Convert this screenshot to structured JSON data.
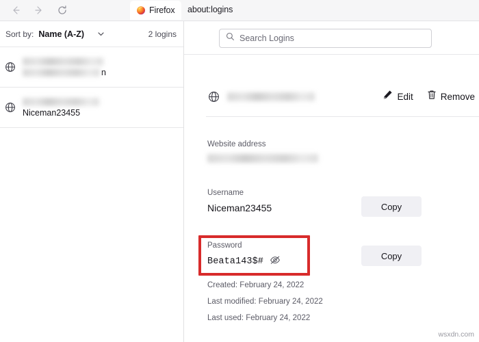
{
  "browser": {
    "nav": {
      "back_icon": "arrow-left-icon",
      "forward_icon": "arrow-right-icon",
      "reload_icon": "reload-icon"
    },
    "tab_label": "Firefox",
    "tab_favicon": "firefox-logo-icon",
    "url": "about:logins"
  },
  "sidebar": {
    "sort_label": "Sort by:",
    "sort_value": "Name (A-Z)",
    "sort_chevron_icon": "chevron-down-icon",
    "logins_count": "2 logins",
    "items": [
      {
        "icon": "globe-icon",
        "title_blurred": true,
        "title": "",
        "subtitle_blurred": true,
        "subtitle": "",
        "subtitle_tail": "n"
      },
      {
        "icon": "globe-icon",
        "title_blurred": true,
        "title": "",
        "subtitle_blurred": false,
        "subtitle": "Niceman23455",
        "subtitle_tail": ""
      }
    ]
  },
  "main": {
    "search": {
      "icon": "search-icon",
      "placeholder": "Search Logins",
      "value": ""
    },
    "login_header": {
      "icon": "globe-icon",
      "site_name_blurred": true,
      "site_name": "",
      "edit_label": "Edit",
      "edit_icon": "pencil-icon",
      "remove_label": "Remove",
      "remove_icon": "trash-icon"
    },
    "fields": {
      "website_label": "Website address",
      "website_value": "",
      "website_blurred": true,
      "username_label": "Username",
      "username_value": "Niceman23455",
      "username_copy_label": "Copy",
      "password_label": "Password",
      "password_value": "Beata143$#",
      "password_reveal_icon": "eye-slash-icon",
      "password_copy_label": "Copy"
    },
    "meta": [
      "Created: February 24, 2022",
      "Last modified: February 24, 2022",
      "Last used: February 24, 2022"
    ]
  },
  "annotation": {
    "highlight_color": "#d82b2b",
    "target": "password-field"
  },
  "watermark": "wsxdn.com"
}
